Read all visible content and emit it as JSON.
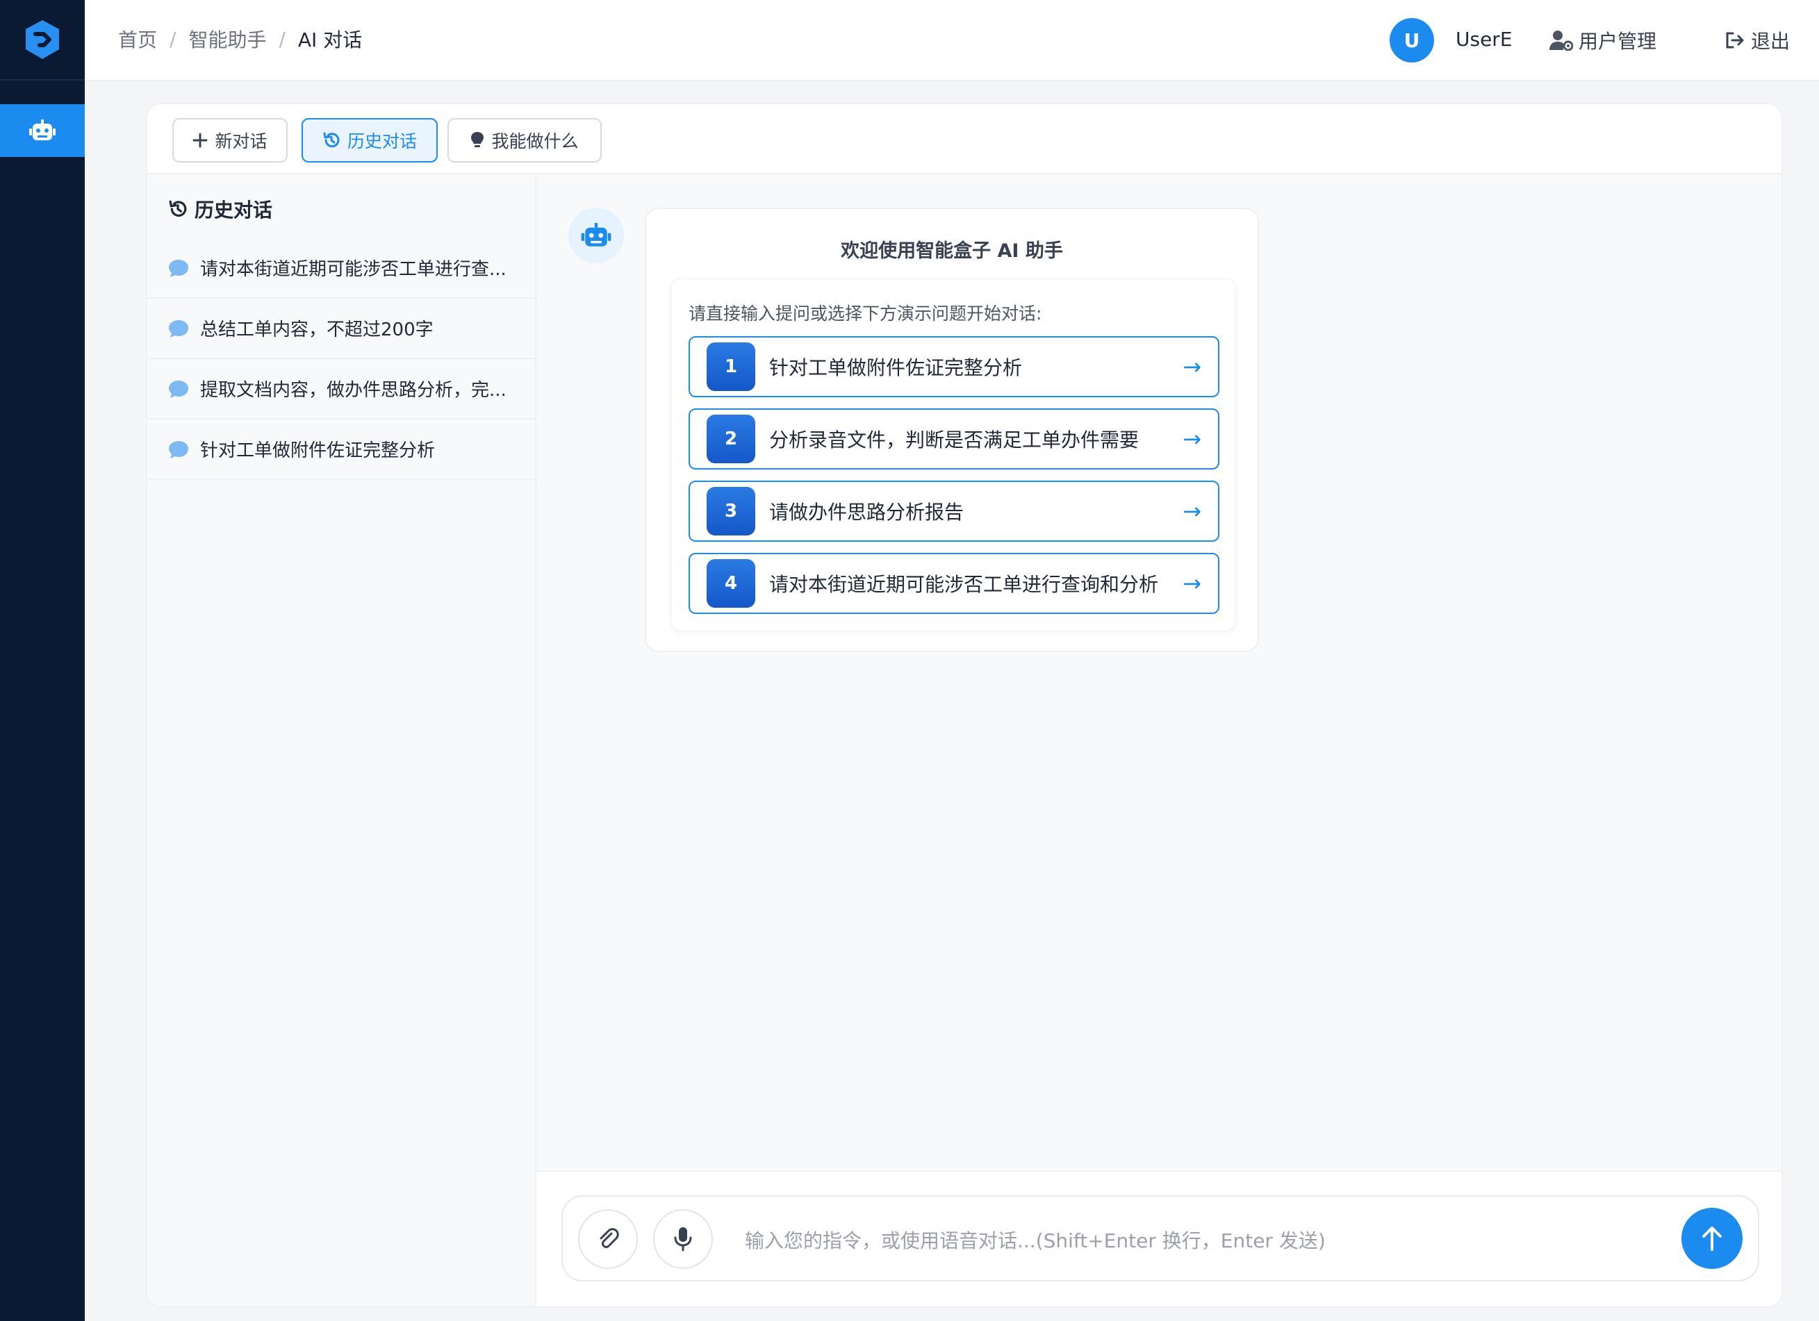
{
  "header": {
    "breadcrumb": [
      "首页",
      "智能助手",
      "AI 对话"
    ],
    "avatar_letter": "U",
    "username": "UserE",
    "user_mgmt_label": "用户管理",
    "logout_label": "退出"
  },
  "toolbar": {
    "new_chat_label": "新对话",
    "history_label": "历史对话",
    "capabilities_label": "我能做什么"
  },
  "history": {
    "title": "历史对话",
    "items": [
      "请对本街道近期可能涉否工单进行查...",
      "总结工单内容，不超过200字",
      "提取文档内容，做办件思路分析，完...",
      "针对工单做附件佐证完整分析"
    ]
  },
  "welcome": {
    "title": "欢迎使用智能盒子 AI 助手",
    "hint": "请直接输入提问或选择下方演示问题开始对话:",
    "questions": [
      {
        "num": "1",
        "text": "针对工单做附件佐证完整分析"
      },
      {
        "num": "2",
        "text": "分析录音文件，判断是否满足工单办件需要"
      },
      {
        "num": "3",
        "text": "请做办件思路分析报告"
      },
      {
        "num": "4",
        "text": "请对本街道近期可能涉否工单进行查询和分析"
      }
    ],
    "arrow": "→"
  },
  "input": {
    "placeholder": "输入您的指令，或使用语音对话...(Shift+Enter 换行，Enter 发送)"
  },
  "colors": {
    "accent": "#1b8bf0",
    "sidebar": "#0b1a33"
  },
  "icons": {
    "logo": "app-logo-icon",
    "nav": "robot-icon",
    "user_mgmt": "user-gear-icon",
    "logout": "logout-icon",
    "new_chat": "plus-icon",
    "history": "history-icon",
    "capabilities": "lightbulb-icon",
    "history_item": "chat-bubble-icon",
    "attach": "paperclip-icon",
    "mic": "microphone-icon",
    "send": "arrow-up-icon"
  }
}
